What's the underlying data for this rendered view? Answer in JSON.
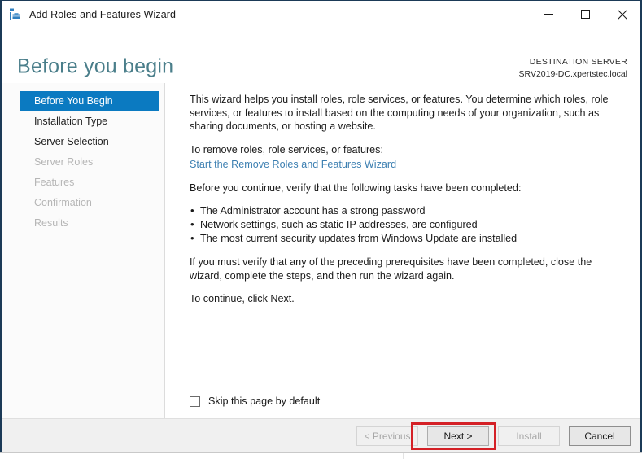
{
  "window": {
    "title": "Add Roles and Features Wizard",
    "icon": "server-wizard-icon",
    "controls": {
      "minimize": "minimize-icon",
      "maximize": "maximize-icon",
      "close": "close-icon"
    }
  },
  "header": {
    "page_title": "Before you begin",
    "destination_label": "DESTINATION SERVER",
    "destination_server": "SRV2019-DC.xpertstec.local"
  },
  "sidebar": {
    "items": [
      {
        "label": "Before You Begin",
        "state": "selected"
      },
      {
        "label": "Installation Type",
        "state": "enabled"
      },
      {
        "label": "Server Selection",
        "state": "enabled"
      },
      {
        "label": "Server Roles",
        "state": "disabled"
      },
      {
        "label": "Features",
        "state": "disabled"
      },
      {
        "label": "Confirmation",
        "state": "disabled"
      },
      {
        "label": "Results",
        "state": "disabled"
      }
    ]
  },
  "content": {
    "intro": "This wizard helps you install roles, role services, or features. You determine which roles, role services, or features to install based on the computing needs of your organization, such as sharing documents, or hosting a website.",
    "remove_prompt": "To remove roles, role services, or features:",
    "remove_link": "Start the Remove Roles and Features Wizard",
    "verify_prompt": "Before you continue, verify that the following tasks have been completed:",
    "tasks": [
      "The Administrator account has a strong password",
      "Network settings, such as static IP addresses, are configured",
      "The most current security updates from Windows Update are installed"
    ],
    "verify_note": "If you must verify that any of the preceding prerequisites have been completed, close the wizard, complete the steps, and then run the wizard again.",
    "continue_note": "To continue, click Next.",
    "skip_checkbox_label": "Skip this page by default",
    "skip_checkbox_checked": false
  },
  "footer": {
    "previous": {
      "label": "< Previous",
      "enabled": false
    },
    "next": {
      "label": "Next >",
      "enabled": true,
      "highlighted": true
    },
    "install": {
      "label": "Install",
      "enabled": false
    },
    "cancel": {
      "label": "Cancel",
      "enabled": true
    }
  },
  "colors": {
    "accent_blue": "#0b7ac1",
    "title_teal": "#4a7e8a",
    "link_blue": "#3c7fb1",
    "highlight_red": "#d42026",
    "window_border": "#1b3a57"
  }
}
